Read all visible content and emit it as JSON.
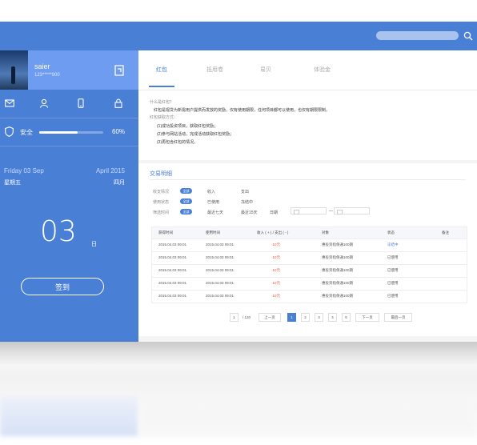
{
  "profile": {
    "name": "saier",
    "phone": "123*****900"
  },
  "sidebar_icons": [
    "mail-icon",
    "user-icon",
    "phone-icon",
    "lock-icon"
  ],
  "security": {
    "label": "安全",
    "percent": 60,
    "percent_text": "60%"
  },
  "calendar": {
    "weekday_en": "Friday  03 Sep",
    "month_en": "April  2015",
    "weekday_cn": "星期五",
    "month_cn": "四月",
    "day": "03",
    "day_unit": "日"
  },
  "checkin_label": "签到",
  "tabs": [
    {
      "label": "红包",
      "active": true
    },
    {
      "label": "抵用卷",
      "active": false
    },
    {
      "label": "易贝",
      "active": false
    },
    {
      "label": "体验金",
      "active": false
    }
  ],
  "info": {
    "q1": "什么是红包？",
    "a1": "红包是视贷为新需用户提供而发放的奖励，仅有使用期限，任何项目都可以使用，也仅有期限限制。",
    "q2": "红包获取方式：",
    "ways": [
      "(1)成功投资项目，获取红包奖励；",
      "(2)参与网站活动，完成活动获取红包奖励；",
      "(3)再包含红包的情况。"
    ]
  },
  "transactions": {
    "title": "交易明细",
    "filters": [
      {
        "label": "收支情况",
        "badge": "全部",
        "options": [
          "收入",
          "支出"
        ]
      },
      {
        "label": "使用状态",
        "badge": "全部",
        "options": [
          "已使用",
          "冻结中"
        ]
      },
      {
        "label": "筛选时间",
        "badge": "全部",
        "options": [
          "最近七天",
          "最近15天",
          "日期"
        ]
      }
    ],
    "date_separator": "—",
    "columns": [
      "获得时间",
      "使用时间",
      "收入 ( + ) / 支出 ( - )",
      "对象",
      "状态",
      "备注"
    ],
    "rows": [
      [
        "2015.04.03  09:01",
        "2015.04.03  09:01",
        "-10元",
        "惠投资指保通100期",
        "冻结中",
        ""
      ],
      [
        "2015.04.03  09:01",
        "2015.04.03  09:01",
        "-10元",
        "惠投资指保通100期",
        "已使用",
        ""
      ],
      [
        "2015.04.03  09:01",
        "2015.04.03  09:01",
        "-10元",
        "惠投资指保通100期",
        "已使用",
        ""
      ],
      [
        "2015.04.03  09:01",
        "2015.04.03  09:01",
        "-10元",
        "惠投资指保通100期",
        "已使用",
        ""
      ],
      [
        "2015.04.03  09:01",
        "2015.04.03  09:01",
        "-10元",
        "惠投资指保通100期",
        "已使用",
        ""
      ]
    ],
    "status_active_color": "#4a7fd6",
    "negative_color": "#e05a3c"
  },
  "pager": {
    "current_input": "1",
    "total": "/ 120",
    "prev": "上一页",
    "pages": [
      "1",
      "2",
      "3",
      "4",
      "5"
    ],
    "next": "下一页",
    "last": "最后一页"
  },
  "colors": {
    "brand": "#4a7fd6",
    "profile_bg": "#6d9cf0"
  }
}
